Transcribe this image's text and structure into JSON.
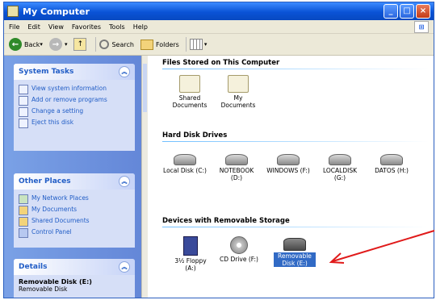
{
  "window": {
    "title": "My Computer"
  },
  "menu": [
    "File",
    "Edit",
    "View",
    "Favorites",
    "Tools",
    "Help"
  ],
  "toolbar": {
    "back": "Back",
    "search": "Search",
    "folders": "Folders"
  },
  "left": {
    "system_tasks": {
      "title": "System Tasks",
      "items": [
        "View system information",
        "Add or remove programs",
        "Change a setting",
        "Eject this disk"
      ]
    },
    "other_places": {
      "title": "Other Places",
      "items": [
        "My Network Places",
        "My Documents",
        "Shared Documents",
        "Control Panel"
      ]
    },
    "details": {
      "title": "Details",
      "name": "Removable Disk (E:)",
      "type": "Removable Disk"
    }
  },
  "sections": {
    "stored": "Files Stored on This Computer",
    "hdd": "Hard Disk Drives",
    "removable": "Devices with Removable Storage"
  },
  "stored_items": [
    "Shared Documents",
    "My Documents"
  ],
  "hdd_items": [
    "Local Disk (C:)",
    "NOTEBOOK (D:)",
    "WINDOWS (F:)",
    "LOCALDISK (G:)",
    "DATOS (H:)"
  ],
  "removable_items": [
    "3½ Floppy (A:)",
    "CD Drive (F:)",
    "Removable Disk (E:)"
  ],
  "colors": {
    "arrow": "#e01a1a",
    "selection": "#316ac5"
  }
}
